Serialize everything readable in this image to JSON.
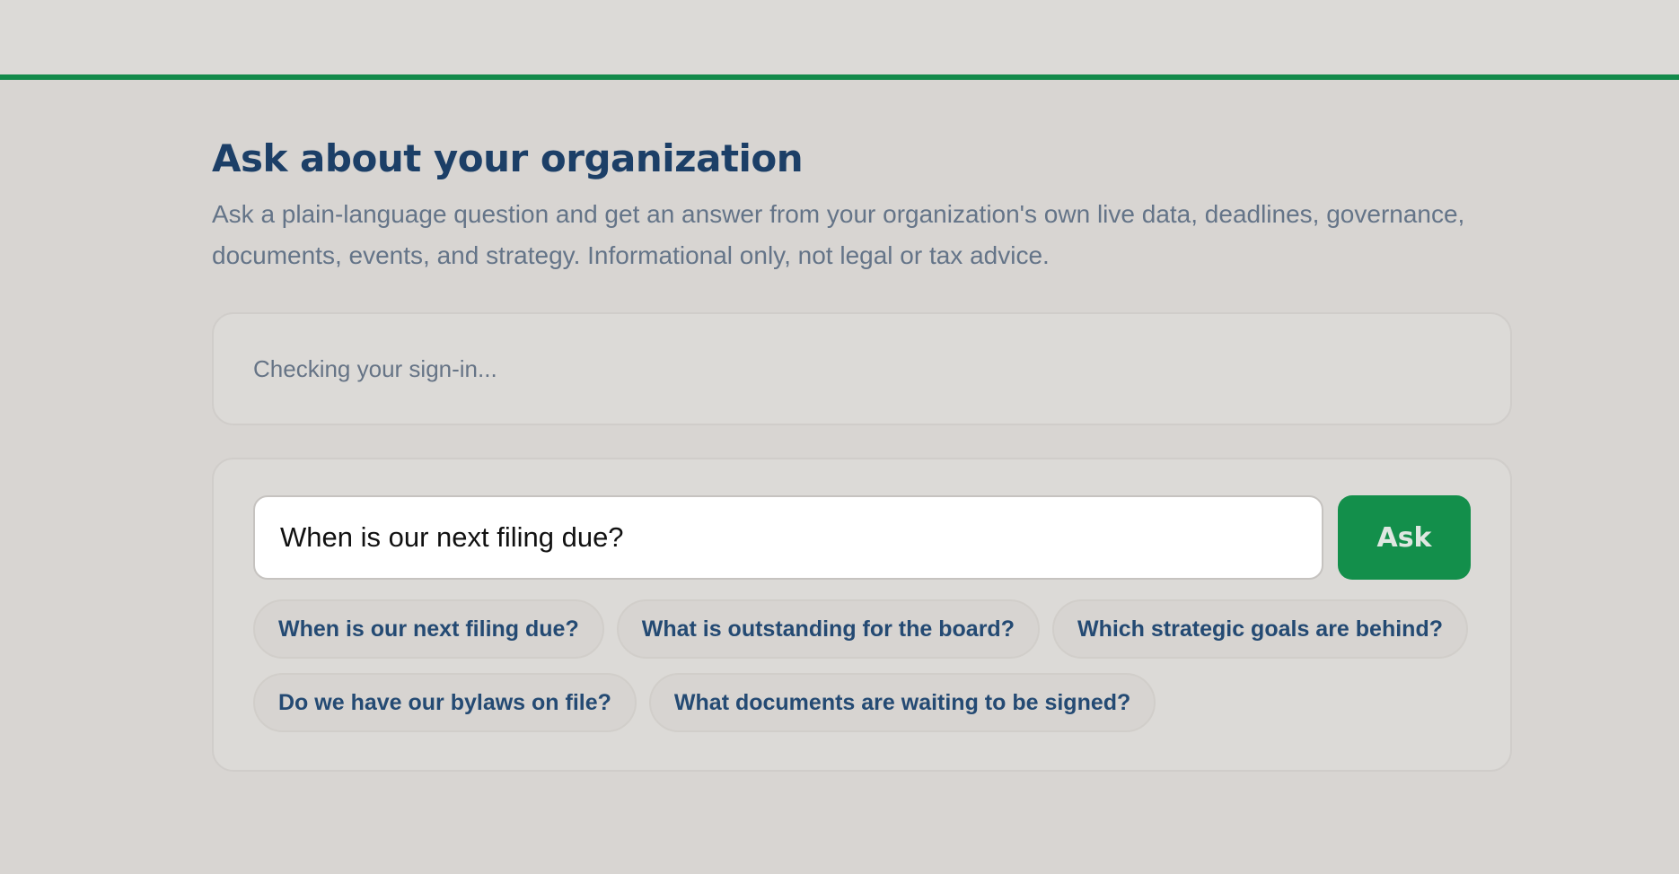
{
  "header": {
    "accent_color": "#138a4a"
  },
  "main": {
    "title": "Ask about your organization",
    "subtitle": "Ask a plain-language question and get an answer from your organization's own live data, deadlines, governance, documents, events, and strategy. Informational only, not legal or tax advice."
  },
  "status": {
    "text": "Checking your sign-in..."
  },
  "ask": {
    "input_value": "When is our next filing due?",
    "button_label": "Ask",
    "button_color": "#138f4b"
  },
  "suggestions": [
    "When is our next filing due?",
    "What is outstanding for the board?",
    "Which strategic goals are behind?",
    "Do we have our bylaws on file?",
    "What documents are waiting to be signed?"
  ]
}
